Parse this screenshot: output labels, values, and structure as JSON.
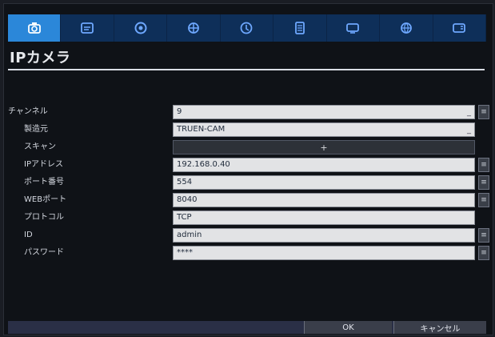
{
  "tabs": [
    {
      "icon": "camera-icon",
      "active": true
    },
    {
      "icon": "record-icon",
      "active": false
    },
    {
      "icon": "alarm-icon",
      "active": false
    },
    {
      "icon": "network-icon",
      "active": false
    },
    {
      "icon": "schedule-icon",
      "active": false
    },
    {
      "icon": "storage-icon",
      "active": false
    },
    {
      "icon": "display-icon",
      "active": false
    },
    {
      "icon": "system-icon",
      "active": false
    },
    {
      "icon": "info-icon",
      "active": false
    }
  ],
  "page": {
    "title": "IPカメラ"
  },
  "form": {
    "channel": {
      "label": "チャンネル",
      "value": "9"
    },
    "maker": {
      "label": "製造元",
      "value": "TRUEN-CAM"
    },
    "scan": {
      "label": "スキャン",
      "glyph": "+"
    },
    "ip": {
      "label": "IPアドレス",
      "value": "192.168.0.40"
    },
    "port": {
      "label": "ポート番号",
      "value": "554"
    },
    "webport": {
      "label": "WEBポート",
      "value": "8040"
    },
    "protocol": {
      "label": "プロトコル",
      "value": "TCP"
    },
    "id": {
      "label": "ID",
      "value": "admin"
    },
    "password": {
      "label": "パスワード",
      "value": "****"
    }
  },
  "buttons": {
    "ok": "OK",
    "cancel": "キャンセル"
  }
}
